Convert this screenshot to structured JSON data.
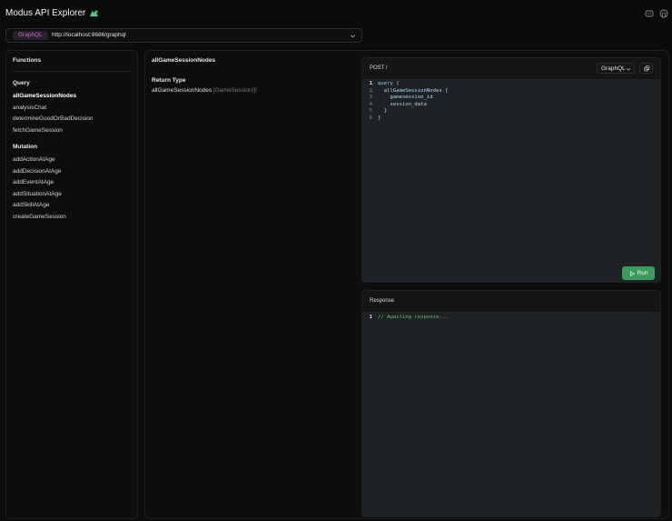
{
  "header": {
    "title": "Modus API Explorer",
    "logo_icon": "bird-logo-icon",
    "icons": [
      "discord-icon",
      "github-icon"
    ]
  },
  "urlbar": {
    "protocol": "GraphQL",
    "url": "http://localhost:8686/graphql"
  },
  "sidebar": {
    "title": "Functions",
    "groups": [
      {
        "label": "Query",
        "items": [
          "allGameSessionNodes",
          "analysisChat",
          "determineGoodOrBadDecision",
          "fetchGameSession"
        ]
      },
      {
        "label": "Mutation",
        "items": [
          "addActionAtAge",
          "addDecisionAtAge",
          "addEventAtAge",
          "addSituationAtAge",
          "addSkillAtAge",
          "createGameSession"
        ]
      }
    ],
    "active_item": "allGameSessionNodes"
  },
  "detail": {
    "title": "allGameSessionNodes",
    "return_type_label": "Return Type",
    "return_name": "allGameSessionNodes",
    "return_type": "[GameSession!]!"
  },
  "editor": {
    "method": "POST /",
    "language": "GraphQL",
    "lines": [
      {
        "n": "1",
        "fold": "⌄",
        "text": "query {"
      },
      {
        "n": "2",
        "fold": "⌄",
        "text": "  allGameSessionNodes {"
      },
      {
        "n": "3",
        "fold": "",
        "text": "    gamesession_id"
      },
      {
        "n": "4",
        "fold": "",
        "text": "    session_data"
      },
      {
        "n": "5",
        "fold": "",
        "text": "  }"
      },
      {
        "n": "6",
        "fold": "",
        "text": "}"
      }
    ],
    "run_label": "Run"
  },
  "response": {
    "title": "Response",
    "lines": [
      {
        "n": "1",
        "text": "// Awaiting response..."
      }
    ]
  },
  "colors": {
    "accent_pill_text": "#c06fbf",
    "run_button": "#3d9a5e",
    "comment": "#6fb16a"
  }
}
